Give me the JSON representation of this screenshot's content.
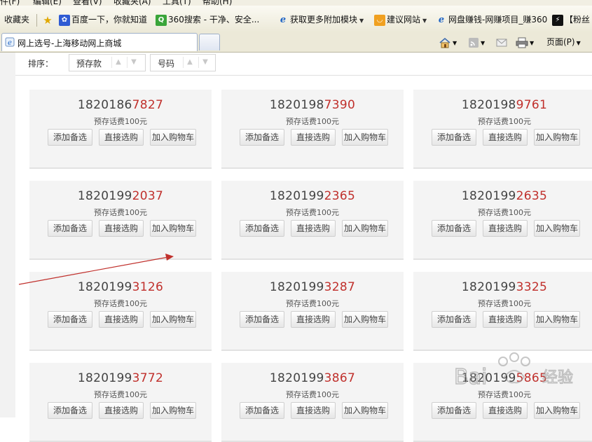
{
  "menu": [
    "件(F)",
    "编辑(E)",
    "查看(V)",
    "收藏夹(A)",
    "工具(T)",
    "帮助(H)"
  ],
  "favorites": {
    "label": "收藏夹",
    "items": [
      {
        "label": "百度一下，你就知道",
        "icon": "baidu-paw-icon"
      },
      {
        "label": "360搜索 - 干净、安全...",
        "icon": "360-search-icon"
      },
      {
        "label": "获取更多附加模块",
        "icon": "ie-icon"
      },
      {
        "label": "建议网站",
        "icon": "suggested-sites-icon"
      },
      {
        "label": "网盘赚钱-网赚项目_赚360",
        "icon": "ie-icon"
      },
      {
        "label": "【粉丝",
        "icon": "page-icon"
      }
    ]
  },
  "tab": {
    "title": "网上选号-上海移动网上商城"
  },
  "commands": {
    "page_label": "页面(P)"
  },
  "sort": {
    "label": "排序：",
    "options": [
      "预存款",
      "号码"
    ]
  },
  "card_labels": {
    "fee": "预存话费100元",
    "add_favorite": "添加备选",
    "buy_direct": "直接选购",
    "add_cart": "加入购物车"
  },
  "numbers": [
    {
      "prefix": "1820186",
      "suffix": "7827"
    },
    {
      "prefix": "1820198",
      "suffix": "7390"
    },
    {
      "prefix": "1820198",
      "suffix": "9761"
    },
    {
      "prefix": "1820199",
      "suffix": "2037"
    },
    {
      "prefix": "1820199",
      "suffix": "2365"
    },
    {
      "prefix": "1820199",
      "suffix": "2635"
    },
    {
      "prefix": "1820199",
      "suffix": "3126"
    },
    {
      "prefix": "1820199",
      "suffix": "3287"
    },
    {
      "prefix": "1820199",
      "suffix": "3325"
    },
    {
      "prefix": "1820199",
      "suffix": "3772"
    },
    {
      "prefix": "1820199",
      "suffix": "3867"
    },
    {
      "prefix": "1820199",
      "suffix": "5865"
    }
  ],
  "colors": {
    "accent_red": "#c0302c",
    "arrow": "#c0302c"
  },
  "watermark": {
    "text": "Bai",
    "suffix_text": "经验"
  }
}
